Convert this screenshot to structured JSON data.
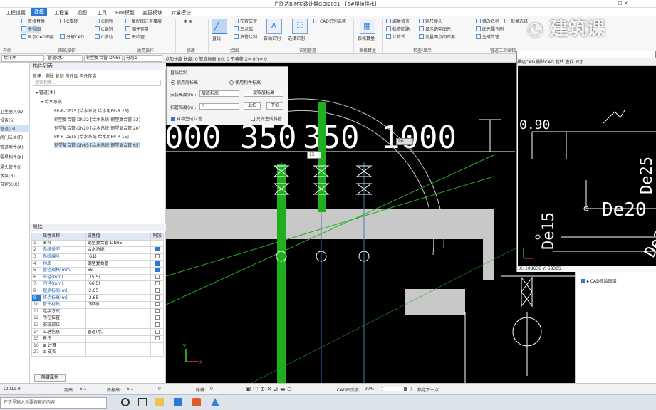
{
  "titlebar": {
    "title": "广联达BIM安装计量GQI2021 - [5#楼给排水]"
  },
  "menu": {
    "tabs": [
      "工程设置",
      "建模",
      "工程量",
      "视图",
      "工具",
      "BIM模型",
      "变更模块",
      "对量模块"
    ]
  },
  "ribbon": {
    "buttons": {
      "a1": "查找替换",
      "a2": "多视图",
      "a3": "显示CAD图层",
      "a4": "分解CAD",
      "a5": "C删除",
      "a6": "C复制",
      "a7": "C移动",
      "a8": "C旋转",
      "b1": "复制图元至楼层",
      "b2": "图元存盘",
      "b3": "云检查",
      "b4": "云存档",
      "c1": "直线",
      "c2": "布置立管",
      "c3": "三点弧",
      "c4": "多管绘制",
      "d1": "自动识别",
      "d2": "选择识别",
      "d3": "CAD识别选项",
      "e1": "表格算量",
      "f1": "漏量检查",
      "f2": "检查回路",
      "f3": "计算式",
      "g1": "定尺接头",
      "g2": "显示选中图元",
      "g3": "测量两点间距离",
      "h1": "修改名称",
      "h2": "图元属性刷",
      "h3": "生成立管",
      "i1": "批量选择",
      "i2": "设备连管",
      "i3": "生成喷头"
    },
    "labels": [
      "开始",
      "图纸操作",
      "通用操作",
      "修改",
      "绘图",
      "识别管道",
      "表格算量",
      "检查/显示",
      "管道二次编辑"
    ]
  },
  "toolbar2": {
    "c1": "给排水",
    "c2": "管道(水)",
    "c3": "钢塑复合管-DN65",
    "c4": "分层1",
    "opts": "点加长度  长度: 0    管底标高(m): 0    不偏移   X= 0   Y= 0"
  },
  "leftstrip": {
    "items": [
      "卫生器具(W)",
      "设备(S)",
      "管道(G)",
      "阀门法兰(F)",
      "管道附件(A)",
      "零星构件(K)",
      "通头管件(J)",
      "水泵(B)",
      "自定义(X)"
    ]
  },
  "complist": {
    "title": "构件列表",
    "toolbar": "新建 · 删除  复制  构件库  构件存盘",
    "search": "搜索构件...",
    "root": "管道(水)",
    "group": "给水系统",
    "items": [
      "PP-R-DE25 [给水系统 给水用PP-R 25]",
      "钢塑复合管-DN32 [给水系统 钢塑复合管 32]",
      "钢塑复合管-DN20 [给水系统 钢塑复合管 20]",
      "PP-R-DE15 [给水系统 给水用PP-R 15]",
      "钢塑复合管-DN65 [给水系统 钢塑复合管 65]"
    ]
  },
  "props": {
    "title": "属性",
    "headers": [
      "属性名称",
      "属性值",
      "附加"
    ],
    "rows": [
      {
        "n": "1",
        "k": "名称",
        "v": "钢塑复合管-DN65",
        "c": ""
      },
      {
        "n": "2",
        "k": "系统类型",
        "v": "给水系统",
        "c": "on"
      },
      {
        "n": "3",
        "k": "系统编号",
        "v": "(G1)",
        "c": "off"
      },
      {
        "n": "4",
        "k": "材质",
        "v": "钢塑复合管",
        "c": "on"
      },
      {
        "n": "5",
        "k": "管径规格(mm)",
        "v": "65",
        "c": "on"
      },
      {
        "n": "6",
        "k": "外径(mm)",
        "v": "(75.5)",
        "c": "off"
      },
      {
        "n": "7",
        "k": "内径(mm)",
        "v": "(66.5)",
        "c": "off"
      },
      {
        "n": "8",
        "k": "起点标高(m)",
        "v": "-2.65",
        "c": "off"
      },
      {
        "n": "9",
        "k": "终点标高(m)",
        "v": "-2.65",
        "c": "off"
      },
      {
        "n": "10",
        "k": "管件材质",
        "v": "(钢制)",
        "c": "off"
      },
      {
        "n": "11",
        "k": "连接方式",
        "v": "",
        "c": "off"
      },
      {
        "n": "12",
        "k": "所在位置",
        "v": "",
        "c": "off"
      },
      {
        "n": "13",
        "k": "安装部位",
        "v": "",
        "c": "off"
      },
      {
        "n": "14",
        "k": "汇总信息",
        "v": "管道(水)",
        "c": "off"
      },
      {
        "n": "15",
        "k": "备注",
        "v": "",
        "c": "off"
      },
      {
        "n": "16",
        "k": "⊕ 计算",
        "v": "",
        "c": ""
      },
      {
        "n": "27",
        "k": "⊕ 支架",
        "v": "",
        "c": ""
      }
    ],
    "button": "隐藏属性"
  },
  "dialog": {
    "title": "直线绘制",
    "radio1": "使用层标高",
    "radio2": "使用构件标高",
    "label1": "安装高度(m):",
    "value1": "层底标高",
    "btn1": "提取层标高",
    "label2": "扣管高度(m):",
    "value2": "0",
    "btn_up": "上扣",
    "btn_down": "下扣",
    "check1": "自动生成立管",
    "check2": "允许生成斜管"
  },
  "canvas": {
    "dims": [
      "000",
      "350",
      "350",
      "1000"
    ],
    "input_a": "15",
    "input_b": "90"
  },
  "floatpanel": {
    "toolbar": "描述CAD  删除CAD  旋转  查找  显示",
    "texts": [
      "0.90",
      "De25",
      "De20",
      "De15",
      "De20"
    ],
    "coords": "X: 108636  Y: 68365"
  },
  "rightpanel": {
    "item": "CAD原始图层"
  },
  "statusbar": {
    "coord": "12019.9",
    "floor_h_label": "层高:",
    "floor_h": "5.1",
    "bottom_label": "底标高:",
    "bottom": "5.1",
    "zero": "0",
    "hide_label": "隐藏:",
    "hide": "0",
    "cad_label": "CAD图亮度:",
    "cad": "97%",
    "point_label": "指定下一点"
  },
  "taskbar": {
    "search": "在这里输入你要搜索的内容"
  },
  "watermark": {
    "text": "建筑课"
  },
  "colors": {
    "accent": "#2b79d6",
    "pipe_green": "#1fb01f",
    "canvas_bg": "#000000",
    "cad_white": "#ffffff"
  }
}
